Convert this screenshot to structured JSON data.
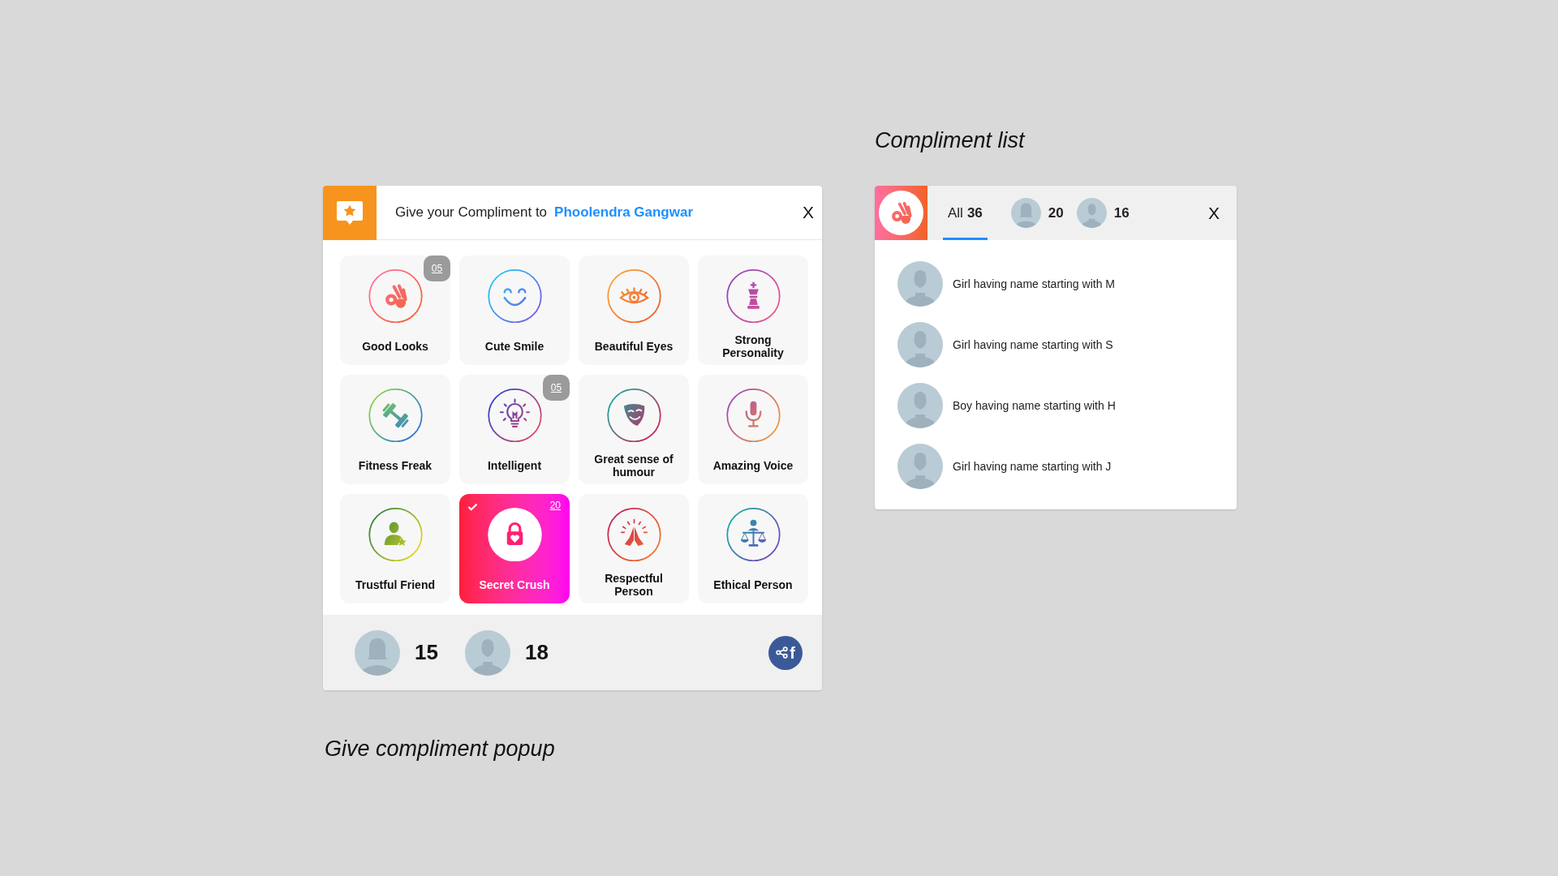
{
  "popup": {
    "header": {
      "prompt": "Give your Compliment to",
      "recipient": "Phoolendra Gangwar",
      "close": "X"
    },
    "compliments": [
      {
        "label": "Good Looks",
        "count": "05",
        "selected": false
      },
      {
        "label": "Cute Smile",
        "selected": false
      },
      {
        "label": "Beautiful Eyes",
        "selected": false
      },
      {
        "label": "Strong Personality",
        "selected": false
      },
      {
        "label": "Fitness Freak",
        "selected": false
      },
      {
        "label": "Intelligent",
        "count": "05",
        "selected": false
      },
      {
        "label": "Great sense of humour",
        "selected": false
      },
      {
        "label": "Amazing Voice",
        "selected": false
      },
      {
        "label": "Trustful Friend",
        "selected": false
      },
      {
        "label": "Secret Crush",
        "count": "20",
        "selected": true
      },
      {
        "label": "Respectful Person",
        "selected": false
      },
      {
        "label": "Ethical Person",
        "selected": false
      }
    ],
    "footer": {
      "stats": [
        {
          "kind": "female",
          "count": "15"
        },
        {
          "kind": "male",
          "count": "18"
        }
      ],
      "share_button": {
        "label": "f"
      }
    },
    "caption": "Give compliment popup"
  },
  "compliment_list": {
    "caption": "Compliment list",
    "tabs": [
      {
        "kind": "all",
        "label": "All",
        "count": "36",
        "selected": true
      },
      {
        "kind": "female",
        "count": "20",
        "selected": false
      },
      {
        "kind": "male",
        "count": "16",
        "selected": false
      }
    ],
    "close": "X",
    "items": [
      {
        "text": "Girl having name starting with M"
      },
      {
        "text": "Girl having name starting with S"
      },
      {
        "text": "Boy having name starting with H"
      },
      {
        "text": "Girl having name starting with J"
      }
    ]
  }
}
